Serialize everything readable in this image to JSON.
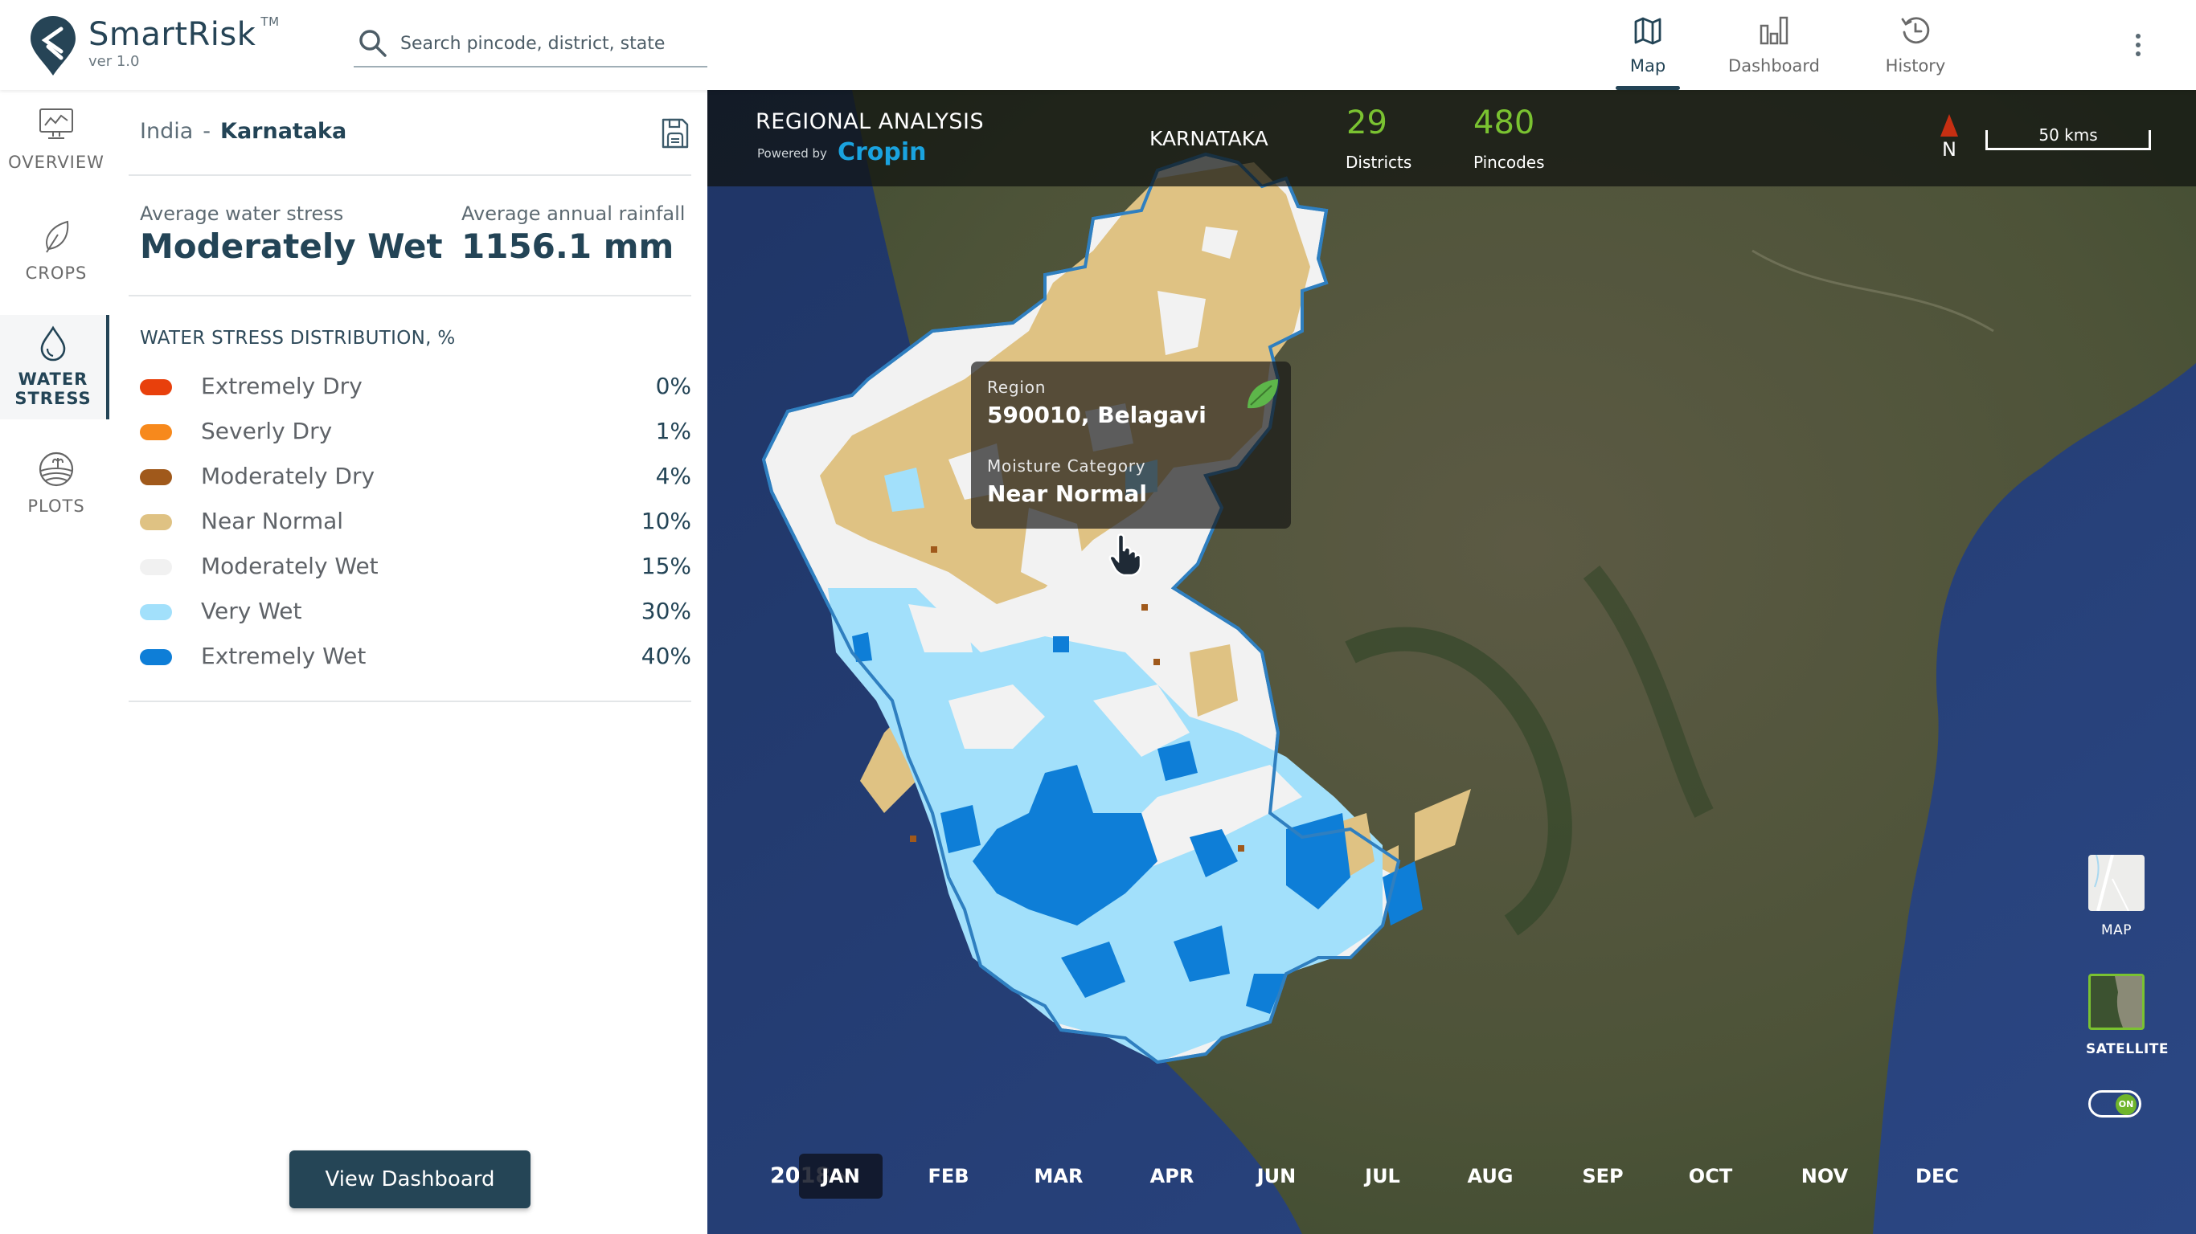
{
  "app": {
    "name": "SmartRisk",
    "trademark": "TM",
    "version": "ver 1.0"
  },
  "search": {
    "placeholder": "Search pincode, district, state",
    "value": ""
  },
  "top_nav": [
    {
      "label": "Map",
      "icon": "map-icon",
      "active": true
    },
    {
      "label": "Dashboard",
      "icon": "bar-chart-icon",
      "active": false
    },
    {
      "label": "History",
      "icon": "history-icon",
      "active": false
    }
  ],
  "rail": [
    {
      "label": "OVERVIEW",
      "icon": "monitor-chart-icon",
      "active": false
    },
    {
      "label": "CROPS",
      "icon": "leaf-icon",
      "active": false
    },
    {
      "label": "WATER STRESS",
      "label_line1": "WATER",
      "label_line2": "STRESS",
      "icon": "water-drop-icon",
      "active": true
    },
    {
      "label": "PLOTS",
      "icon": "field-plot-icon",
      "active": false
    }
  ],
  "panel": {
    "breadcrumb": {
      "country": "India",
      "separator": "-",
      "state": "Karnataka"
    },
    "avg_water_stress_label": "Average water stress",
    "avg_water_stress_value": "Moderately Wet",
    "avg_rainfall_label": "Average annual rainfall",
    "avg_rainfall_value": "1156.1 mm",
    "distribution_title": "WATER STRESS DISTRIBUTION, %",
    "distribution": [
      {
        "label": "Extremely Dry",
        "value": "0%",
        "color": "#e8400c"
      },
      {
        "label": "Severly Dry",
        "value": "1%",
        "color": "#f7891c"
      },
      {
        "label": "Moderately Dry",
        "value": "4%",
        "color": "#a0591b"
      },
      {
        "label": "Near Normal",
        "value": "10%",
        "color": "#dfc283"
      },
      {
        "label": "Moderately Wet",
        "value": "15%",
        "color": "#f1f1f1"
      },
      {
        "label": "Very Wet",
        "value": "30%",
        "color": "#a2e0fb"
      },
      {
        "label": "Extremely Wet",
        "value": "40%",
        "color": "#0e7ed7"
      }
    ],
    "view_dashboard_label": "View Dashboard"
  },
  "map": {
    "title": "REGIONAL ANALYSIS",
    "powered_by": "Powered by",
    "powered_brand": "Cropin",
    "state": "KARNATAKA",
    "districts_count": "29",
    "districts_label": "Districts",
    "pincodes_count": "480",
    "pincodes_label": "Pincodes",
    "north_label": "N",
    "scale_label": "50 kms",
    "tooltip": {
      "region_label": "Region",
      "region_value": "590010, Belagavi",
      "category_label": "Moisture Category",
      "category_value": "Near Normal"
    },
    "layers": [
      {
        "label": "MAP",
        "selected": false
      },
      {
        "label": "SATELLITE",
        "selected": true
      }
    ],
    "toggle_label": "ON",
    "toggle_state": "on",
    "year": "2018",
    "months": [
      "JAN",
      "FEB",
      "MAR",
      "APR",
      "JUN",
      "JUL",
      "AUG",
      "SEP",
      "OCT",
      "NOV",
      "DEC"
    ],
    "active_month": "JAN",
    "accent_green": "#7ac231",
    "brand_dark": "#234456"
  }
}
